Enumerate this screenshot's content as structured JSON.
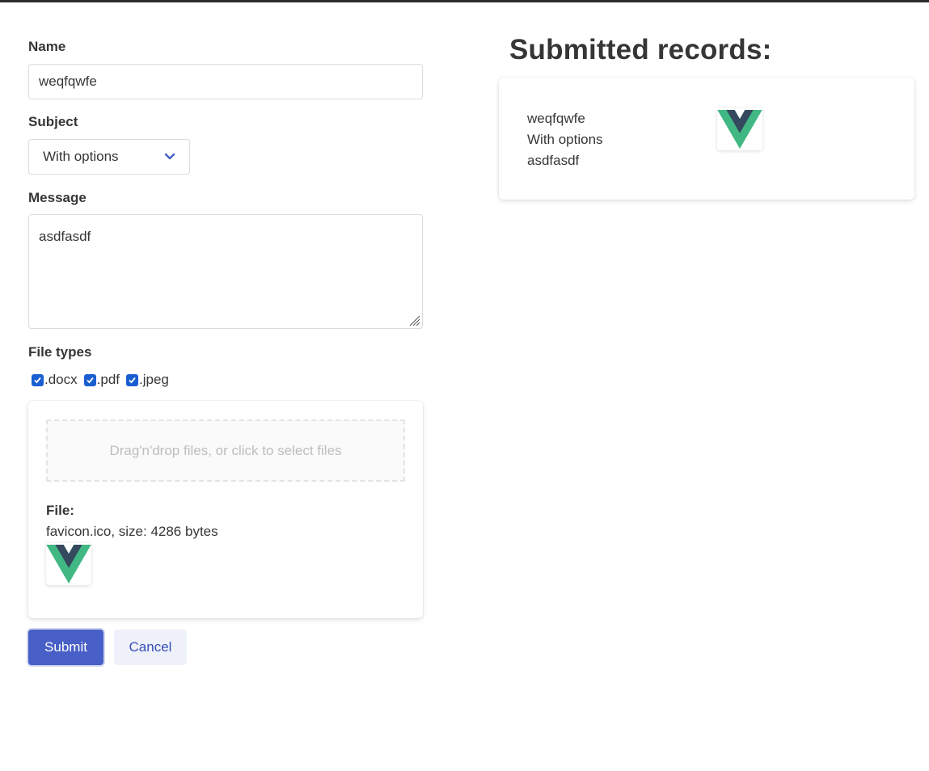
{
  "form": {
    "name_label": "Name",
    "name_value": "weqfqwfe",
    "subject_label": "Subject",
    "subject_value": "With options",
    "message_label": "Message",
    "message_value": "asdfasdf",
    "file_types_label": "File types",
    "file_types": [
      {
        "label": ".docx",
        "checked": true
      },
      {
        "label": ".pdf",
        "checked": true
      },
      {
        "label": ".jpeg",
        "checked": true
      }
    ],
    "dropzone_text": "Drag'n'drop files, or click to select files",
    "file_label": "File:",
    "file_info": "favicon.ico, size: 4286 bytes",
    "submit_label": "Submit",
    "cancel_label": "Cancel"
  },
  "records": {
    "title": "Submitted records:",
    "items": [
      {
        "name": "weqfqwfe",
        "subject": "With options",
        "message": "asdfasdf",
        "icon": "vue-logo-icon"
      }
    ]
  },
  "colors": {
    "primary": "#485fc7",
    "vue_green": "#41b883",
    "vue_dark": "#34495e",
    "checkbox": "#1a5fd1"
  }
}
